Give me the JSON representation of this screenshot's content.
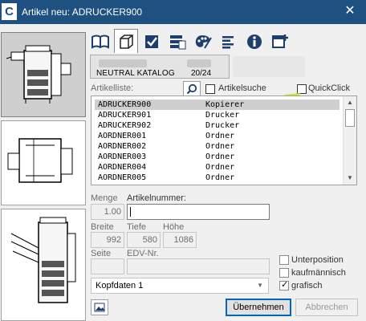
{
  "window": {
    "app_icon": "C",
    "title": "Artikel neu: ADRUCKER900",
    "close_glyph": "✕"
  },
  "thumbnails": [
    {
      "icon": "copier-with-finisher-icon"
    },
    {
      "icon": "document-tray-icon"
    },
    {
      "icon": "copier-with-paper-trays-icon"
    }
  ],
  "toolbar": {
    "tabs": [
      {
        "icon": "book-icon"
      },
      {
        "icon": "box-icon"
      },
      {
        "icon": "checkbox-icon"
      },
      {
        "icon": "stack-icon"
      },
      {
        "icon": "palette-icon"
      },
      {
        "icon": "text-lines-icon"
      },
      {
        "icon": "info-icon"
      },
      {
        "icon": "add-window-icon"
      }
    ]
  },
  "info": {
    "catalog": "NEUTRAL KATALOG",
    "count": "20/24"
  },
  "list": {
    "label": "Artikelliste:",
    "search_label": "Artikelsuche",
    "quickclick_label": "QuickClick",
    "rows": [
      {
        "code": "ADRUCKER900",
        "name": "Kopierer"
      },
      {
        "code": "ADRUCKER901",
        "name": "Drucker"
      },
      {
        "code": "ADRUCKER902",
        "name": "Drucker"
      },
      {
        "code": "AORDNER001",
        "name": "Ordner"
      },
      {
        "code": "AORDNER002",
        "name": "Ordner"
      },
      {
        "code": "AORDNER003",
        "name": "Ordner"
      },
      {
        "code": "AORDNER004",
        "name": "Ordner"
      },
      {
        "code": "AORDNER005",
        "name": "Ordner"
      }
    ]
  },
  "form": {
    "menge_label": "Menge",
    "menge_value": "1.00",
    "artikelnummer_label": "Artikelnummer:",
    "artikelnummer_value": "",
    "breite_label": "Breite",
    "breite_value": "992",
    "tiefe_label": "Tiefe",
    "tiefe_value": "580",
    "hoehe_label": "Höhe",
    "hoehe_value": "1086",
    "seite_label": "Seite",
    "seite_value": "",
    "edv_label": "EDV-Nr.",
    "edv_value": "",
    "unterposition_label": "Unterposition",
    "kaufmaennisch_label": "kaufmännisch",
    "grafisch_label": "grafisch",
    "kopfdaten_value": "Kopfdaten 1"
  },
  "buttons": {
    "uebernehmen": "Übernehmen",
    "abbrechen": "Abbrechen"
  },
  "colors": {
    "titlebar": "#1e5080",
    "hint_arrow": "#d4e22b",
    "selection": "#cfcfcf"
  }
}
